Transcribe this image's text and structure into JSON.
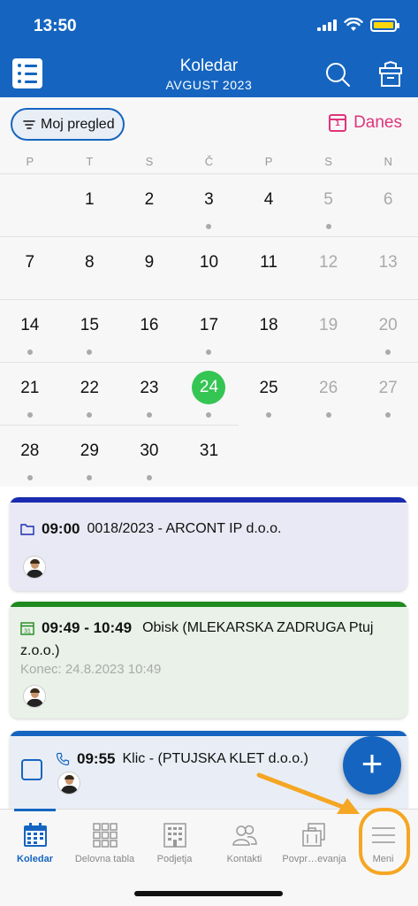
{
  "status": {
    "time": "13:50"
  },
  "header": {
    "title": "Koledar",
    "subtitle": "AVGUST 2023"
  },
  "toolbar": {
    "filter_label": "Moj pregled",
    "today_label": "Danes",
    "today_icon_day": "1"
  },
  "calendar": {
    "weekdays": [
      "P",
      "T",
      "S",
      "Č",
      "P",
      "S",
      "N"
    ],
    "weeks": [
      [
        {
          "d": ""
        },
        {
          "d": "1"
        },
        {
          "d": "2"
        },
        {
          "d": "3",
          "dot": true
        },
        {
          "d": "4"
        },
        {
          "d": "5",
          "muted": true,
          "dot": true
        },
        {
          "d": "6",
          "muted": true
        }
      ],
      [
        {
          "d": "7"
        },
        {
          "d": "8"
        },
        {
          "d": "9"
        },
        {
          "d": "10"
        },
        {
          "d": "11"
        },
        {
          "d": "12",
          "muted": true
        },
        {
          "d": "13",
          "muted": true
        }
      ],
      [
        {
          "d": "14",
          "dot": true
        },
        {
          "d": "15",
          "dot": true
        },
        {
          "d": "16"
        },
        {
          "d": "17",
          "dot": true
        },
        {
          "d": "18"
        },
        {
          "d": "19",
          "muted": true
        },
        {
          "d": "20",
          "muted": true,
          "dot": true
        }
      ],
      [
        {
          "d": "21",
          "dot": true
        },
        {
          "d": "22",
          "dot": true
        },
        {
          "d": "23",
          "dot": true
        },
        {
          "d": "24",
          "selected": true,
          "dot": true
        },
        {
          "d": "25",
          "dot": true
        },
        {
          "d": "26",
          "muted": true,
          "dot": true
        },
        {
          "d": "27",
          "muted": true,
          "dot": true
        }
      ],
      [
        {
          "d": "28",
          "dot": true
        },
        {
          "d": "29",
          "dot": true
        },
        {
          "d": "30",
          "dot": true
        },
        {
          "d": "31"
        },
        {
          "d": ""
        },
        {
          "d": ""
        },
        {
          "d": ""
        }
      ]
    ]
  },
  "events": [
    {
      "time": "09:00",
      "title": "0018/2023 - ARCONT IP d.o.o.",
      "icon": "folder-icon",
      "accent": "#1a2bb0",
      "bg": "#e9e9f5"
    },
    {
      "time": "09:49 - 10:49",
      "title": "Obisk (MLEKARSKA ZADRUGA Ptuj",
      "title2": "z.o.o.)",
      "end": "Konec: 24.8.2023 10:49",
      "icon": "calendar-icon",
      "accent": "#1f8a1f",
      "bg": "#e9f1e8"
    },
    {
      "time": "09:55",
      "title": "Klic -  (PTUJSKA KLET d.o.o.)",
      "icon": "phone-icon",
      "accent": "#1565c0",
      "bg": "#e9eef6"
    }
  ],
  "fab": {
    "label": "+"
  },
  "nav": [
    {
      "label": "Koledar",
      "icon": "calendar-icon",
      "active": true
    },
    {
      "label": "Delovna tabla",
      "icon": "grid-icon"
    },
    {
      "label": "Podjetja",
      "icon": "building-icon"
    },
    {
      "label": "Kontakti",
      "icon": "contacts-icon"
    },
    {
      "label": "Povpr…evanja",
      "icon": "briefcase-icon"
    },
    {
      "label": "Meni",
      "icon": "hamburger-icon"
    }
  ],
  "colors": {
    "primary": "#1565c0",
    "today": "#e0347a",
    "selected": "#35c553",
    "annotation": "#f5a623"
  }
}
